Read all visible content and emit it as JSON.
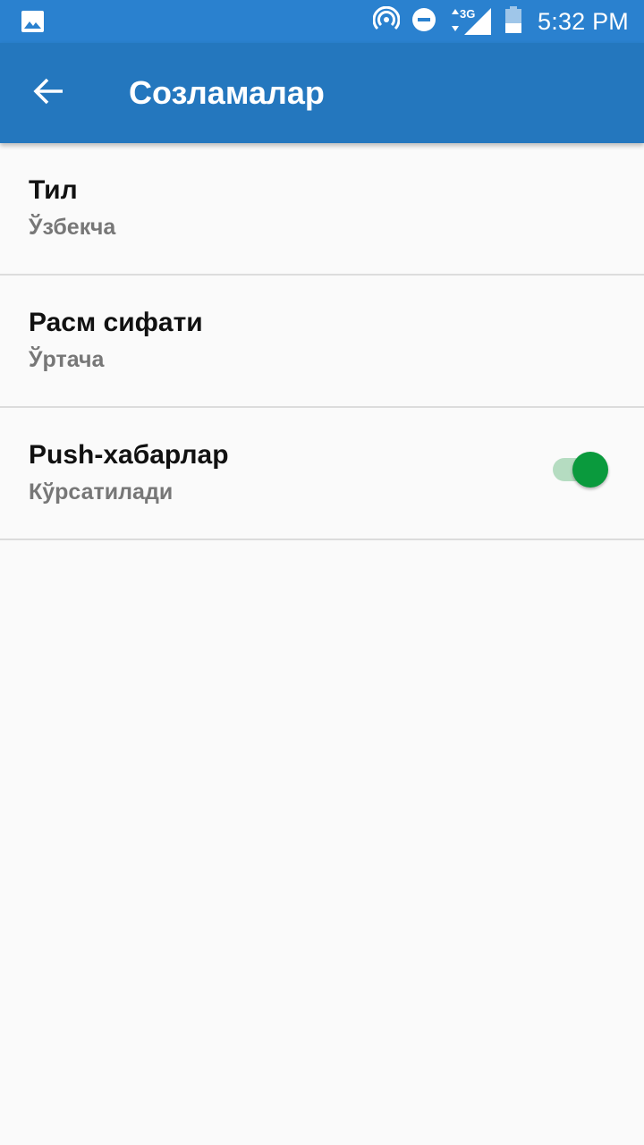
{
  "status_bar": {
    "time": "5:32 PM",
    "network": "3G",
    "icons": [
      "image-icon",
      "hotspot-icon",
      "do-not-disturb-icon",
      "signal-icon",
      "battery-icon"
    ]
  },
  "app_bar": {
    "title": "Созламалар",
    "back_icon": "arrow-back-icon"
  },
  "settings": [
    {
      "title": "Тил",
      "value": "Ўзбекча"
    },
    {
      "title": "Расм сифати",
      "value": "Ўртача"
    },
    {
      "title": "Push-хабарлар",
      "value": "Кўрсатилади",
      "toggle_on": true
    }
  ],
  "colors": {
    "status_bar": "#2a81cf",
    "app_bar": "#2477be",
    "toggle_accent": "#0a9a3d",
    "background": "#fafafa"
  }
}
